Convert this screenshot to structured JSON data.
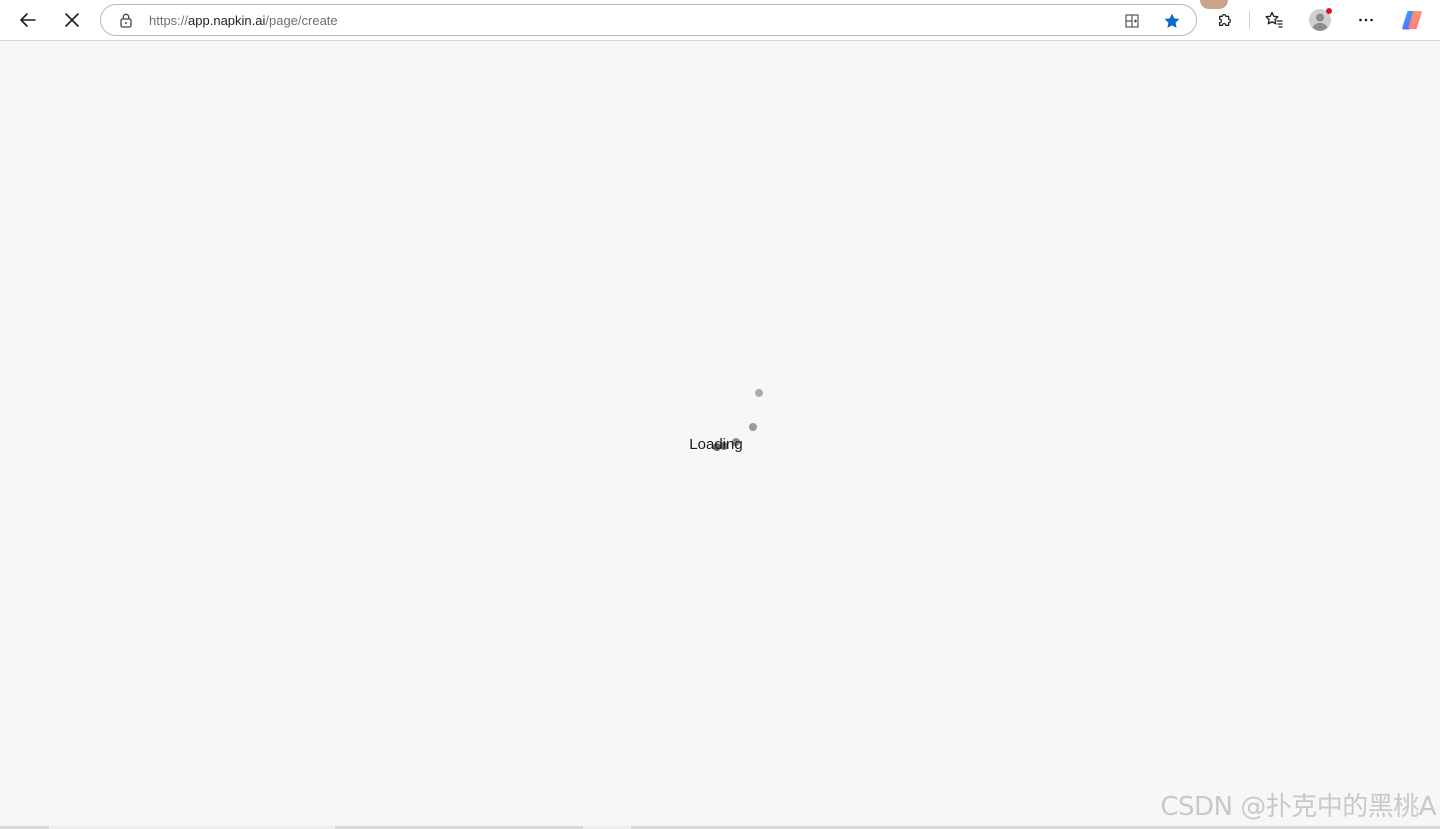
{
  "browser": {
    "url_scheme": "https://",
    "url_host": "app.napkin.ai",
    "url_path": "/page/create",
    "icons": {
      "back": "back-arrow-icon",
      "stop": "close-icon",
      "lock": "lock-icon",
      "split": "split-screen-icon",
      "favorite": "star-icon",
      "extensions": "puzzle-icon",
      "favorites_list": "favorites-icon",
      "profile": "profile-icon",
      "menu": "more-icon",
      "copilot": "copilot-icon"
    },
    "accent_color": "#0b6bcb"
  },
  "page": {
    "loading_label": "Loading"
  },
  "overlay": {
    "watermark": "CSDN @扑克中的黑桃A"
  }
}
